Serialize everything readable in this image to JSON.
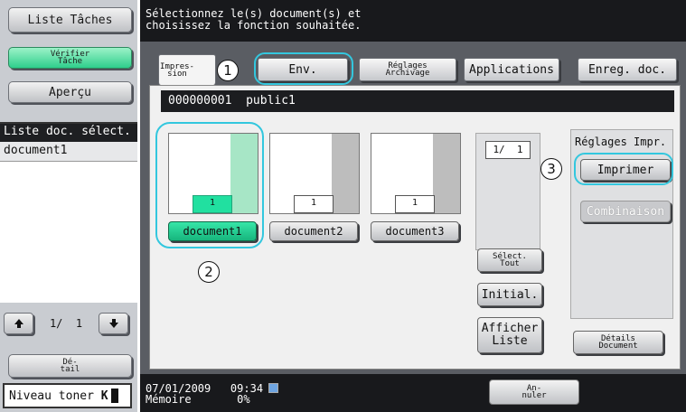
{
  "left": {
    "liste_taches": "Liste Tâches",
    "verifier_tache": "Vérifier\nTâche",
    "apercu": "Aperçu",
    "liste_header": "Liste doc. sélect.",
    "liste_items": [
      "document1"
    ],
    "page_indicator": "1/  1",
    "detail": "Dé-\ntail",
    "toner_label": "Niveau toner",
    "toner_glyph": "K"
  },
  "header": {
    "message": "Sélectionnez le(s) document(s) et\nchoisissez la fonction souhaitée."
  },
  "tabs": {
    "impression": "Impres-\nsion",
    "env": "Env.",
    "reglages_archivage": "Réglages\nArchivage",
    "applications": "Applications",
    "enreg_doc": "Enreg. doc."
  },
  "doc_bar": "000000001  public1",
  "documents": [
    {
      "name": "document1",
      "page": "1",
      "selected": true
    },
    {
      "name": "document2",
      "page": "1",
      "selected": false
    },
    {
      "name": "document3",
      "page": "1",
      "selected": false
    }
  ],
  "pages": "1/  1",
  "buttons": {
    "select_tout": "Sélect.\nTout",
    "initial": "Initial.",
    "afficher_liste": "Afficher\nListe",
    "details_document": "Détails\nDocument",
    "annuler": "An-\nnuler"
  },
  "reglages": {
    "title": "Réglages Impr.",
    "imprimer": "Imprimer",
    "combinaison": "Combinaison"
  },
  "callouts": [
    "1",
    "2",
    "3"
  ],
  "footer": {
    "datetime": "07/01/2009   09:34",
    "memoire_label": "Mémoire",
    "memoire_value": "0%"
  }
}
